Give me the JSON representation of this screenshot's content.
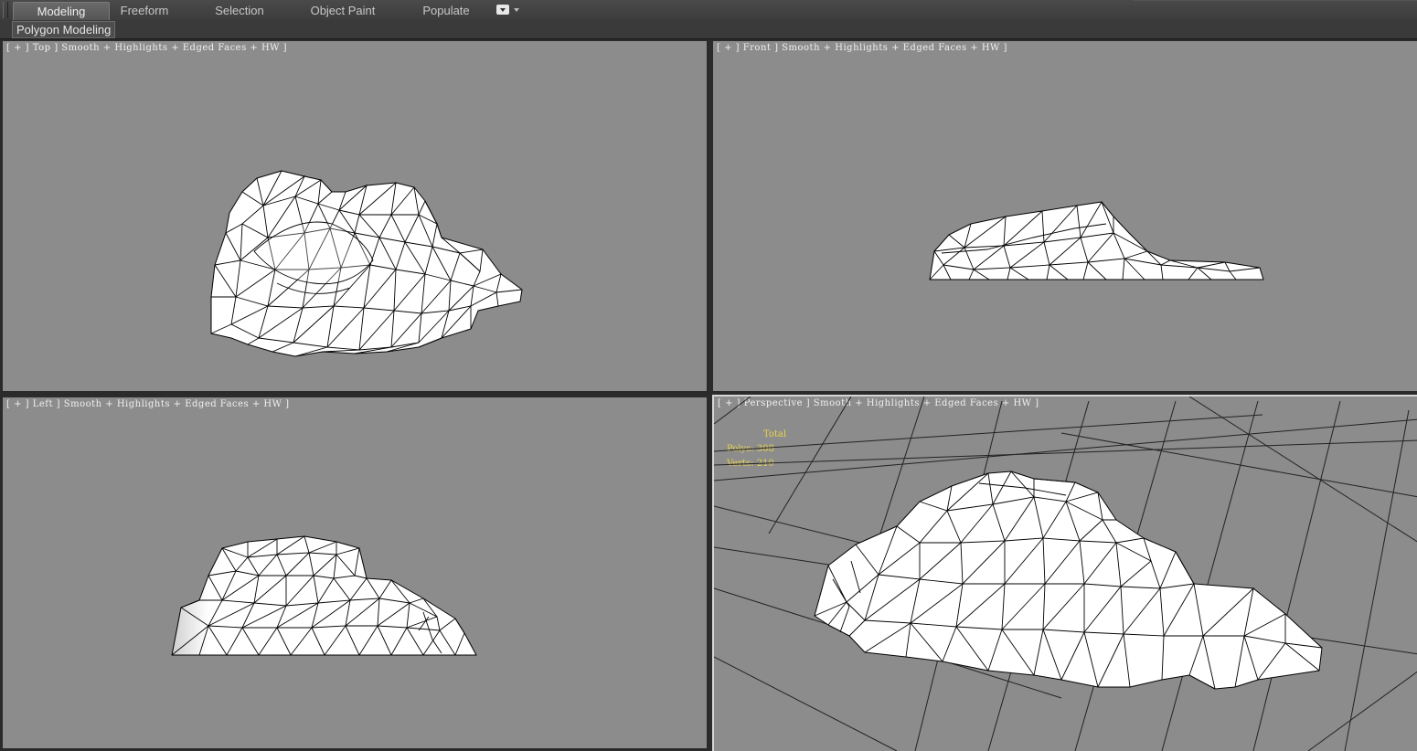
{
  "ribbon": {
    "tabs": [
      {
        "label": "Modeling",
        "active": true
      },
      {
        "label": "Freeform",
        "active": false
      },
      {
        "label": "Selection",
        "active": false
      },
      {
        "label": "Object Paint",
        "active": false
      },
      {
        "label": "Populate",
        "active": false
      }
    ],
    "panel_label": "Polygon Modeling"
  },
  "viewports": {
    "top": {
      "label": "[ + ] Top ] Smooth + Highlights + Edged Faces + HW ]"
    },
    "front": {
      "label": "[ + ] Front ] Smooth + Highlights + Edged Faces + HW ]"
    },
    "left": {
      "label": "[ + ] Left ] Smooth + Highlights + Edged Faces + HW ]"
    },
    "perspective": {
      "label": "[ + ] Perspective ] Smooth + Highlights + Edged Faces + HW ]",
      "stats": {
        "title": "Total",
        "polys": "Polys: 308",
        "verts": "Verts: 210"
      }
    }
  },
  "colors": {
    "viewport_bg": "#8c8c8c",
    "mesh_fill": "#ffffff",
    "mesh_edge": "#000000",
    "stats_text": "#e8d44a",
    "active_border": "#d6d6d6"
  }
}
